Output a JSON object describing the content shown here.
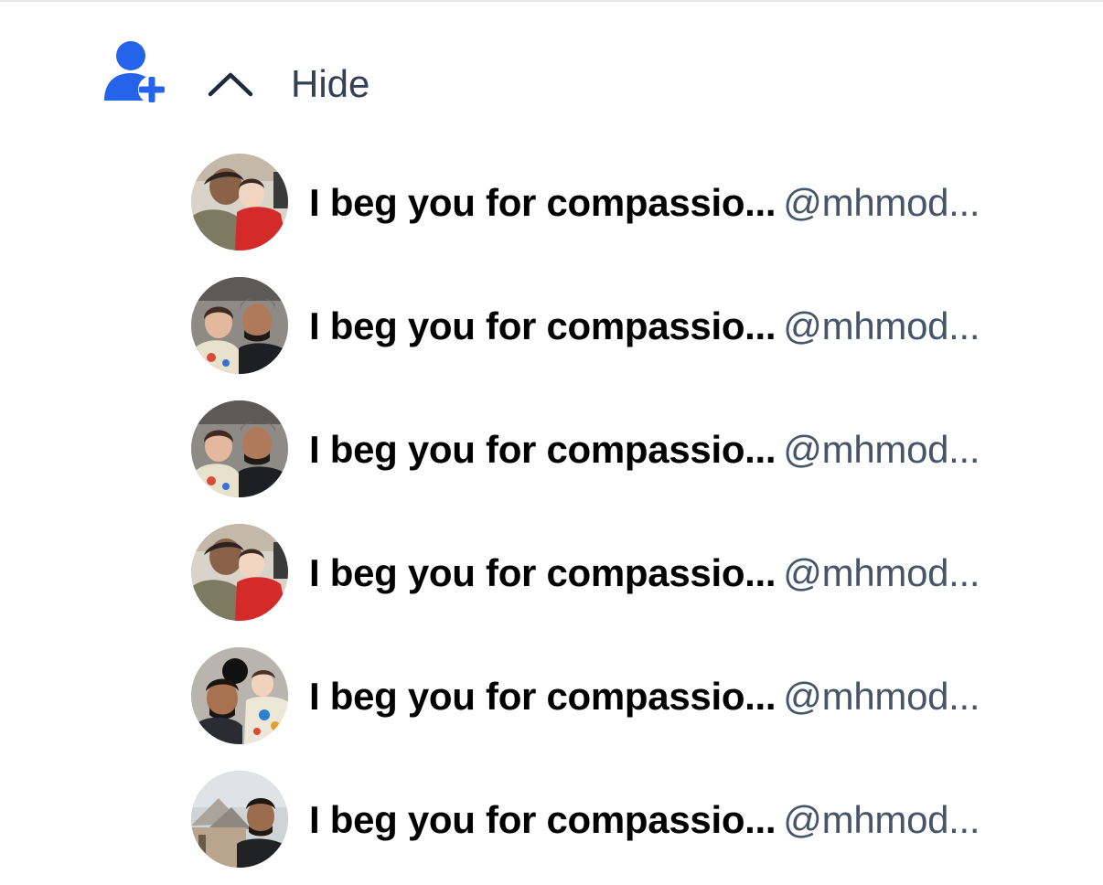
{
  "colors": {
    "accent": "#2563eb",
    "title": "#000000",
    "handle": "#475569",
    "toggle": "#334155"
  },
  "header": {
    "add_icon": "user-plus-icon",
    "toggle_icon": "chevron-up-icon",
    "toggle_label": "Hide"
  },
  "list": {
    "items": [
      {
        "title": "I beg you for compassio...",
        "handle": "@mhmod...",
        "avatar": "avatar-photo-father-kissing-child"
      },
      {
        "title": "I beg you for compassio...",
        "handle": "@mhmod...",
        "avatar": "avatar-photo-selfie-man-and-girl"
      },
      {
        "title": "I beg you for compassio...",
        "handle": "@mhmod...",
        "avatar": "avatar-photo-selfie-man-and-girl"
      },
      {
        "title": "I beg you for compassio...",
        "handle": "@mhmod...",
        "avatar": "avatar-photo-father-kissing-child"
      },
      {
        "title": "I beg you for compassio...",
        "handle": "@mhmod...",
        "avatar": "avatar-photo-man-with-girl"
      },
      {
        "title": "I beg you for compassio...",
        "handle": "@mhmod...",
        "avatar": "avatar-photo-man-outdoors-tent"
      }
    ]
  }
}
